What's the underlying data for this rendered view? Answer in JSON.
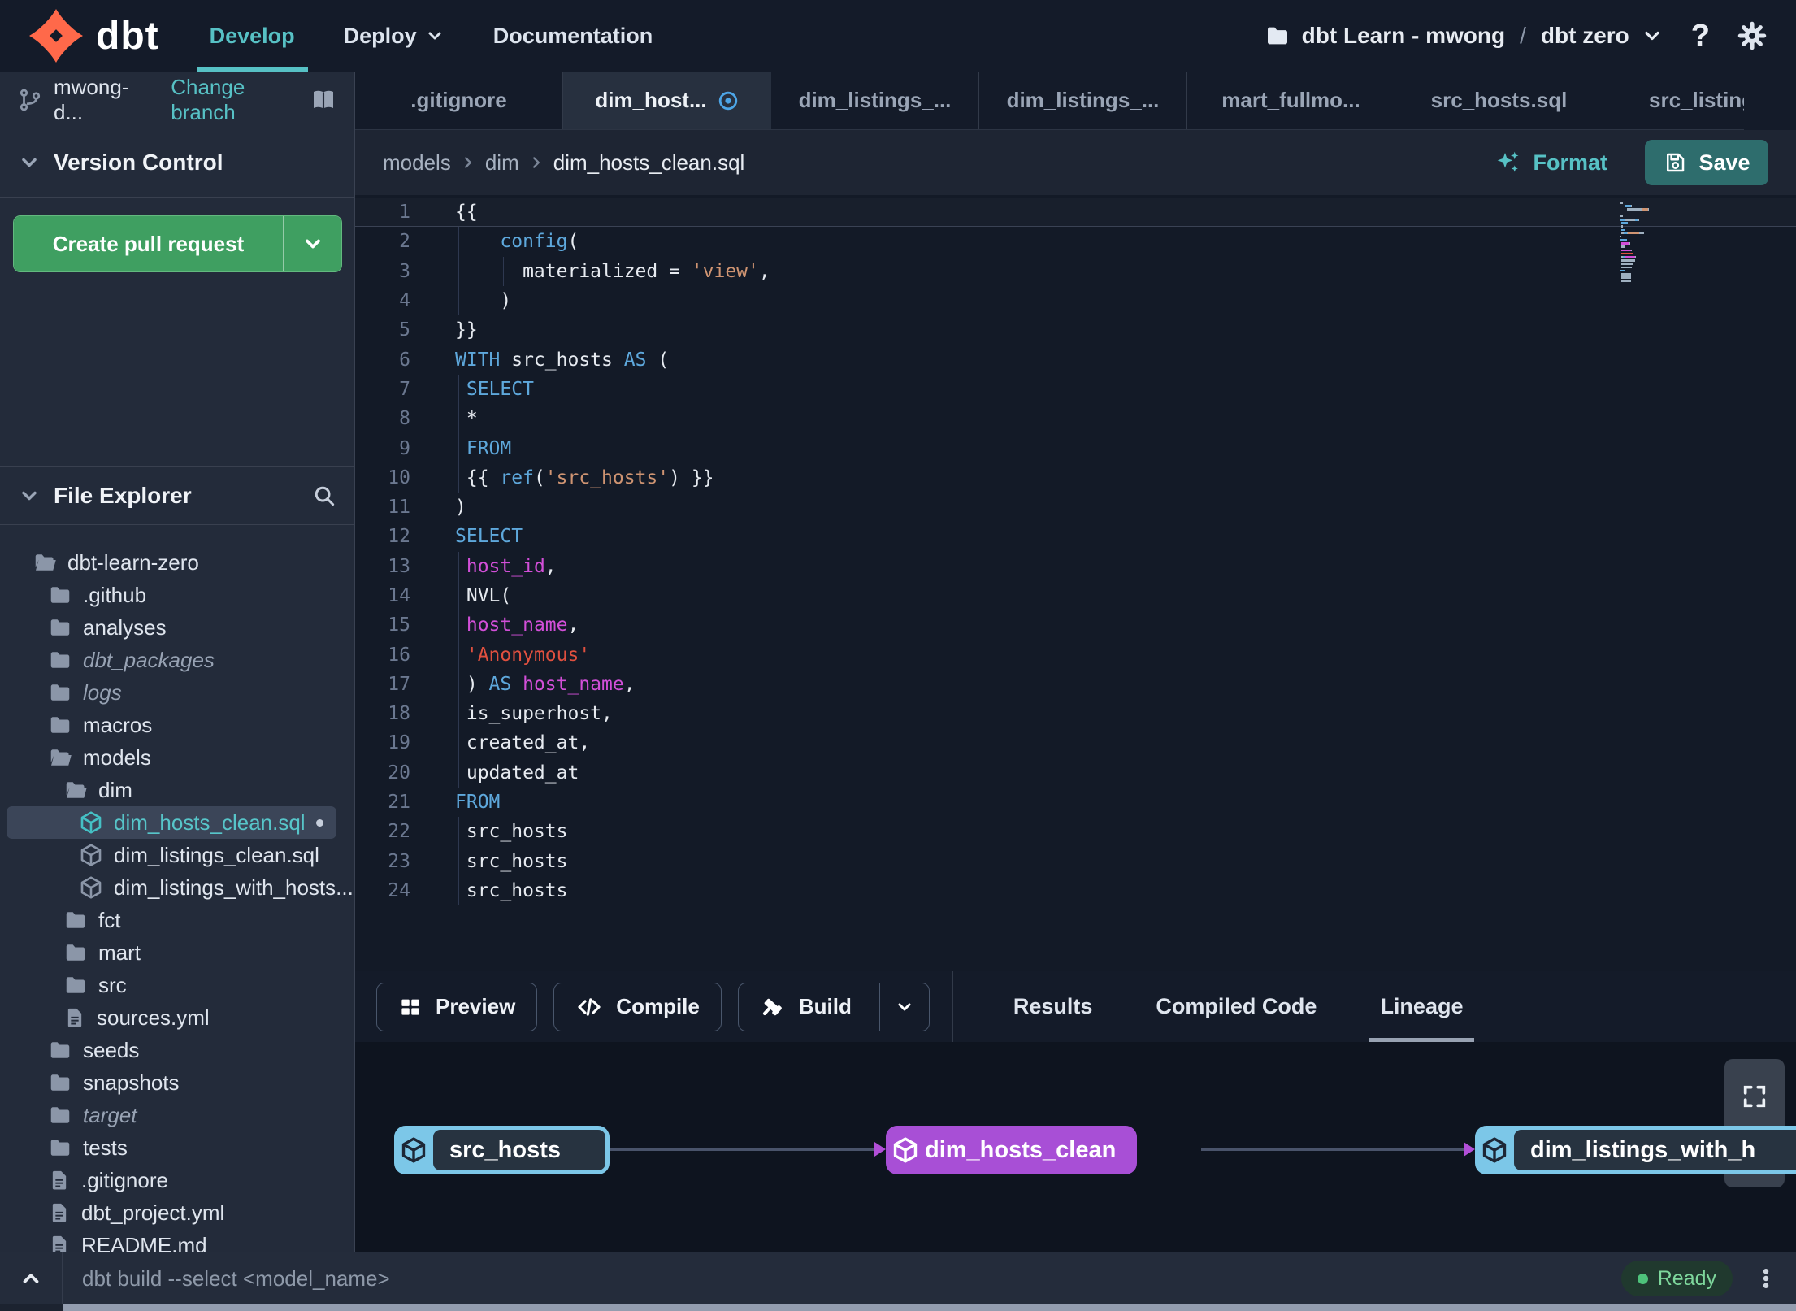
{
  "nav": {
    "brand": "dbt",
    "items": [
      {
        "label": "Develop",
        "active": true
      },
      {
        "label": "Deploy",
        "chevron": true
      },
      {
        "label": "Documentation"
      }
    ],
    "project": {
      "account": "dbt Learn - mwong",
      "separator": "/",
      "env": "dbt zero"
    }
  },
  "sidebar": {
    "branch": {
      "name": "mwong-d...",
      "action": "Change branch"
    },
    "version_control": {
      "title": "Version Control",
      "button": "Create pull request"
    },
    "file_explorer": {
      "title": "File Explorer"
    },
    "tree": [
      {
        "name": "dbt-learn-zero",
        "type": "folder-open",
        "depth": 0
      },
      {
        "name": ".github",
        "type": "folder",
        "depth": 1
      },
      {
        "name": "analyses",
        "type": "folder",
        "depth": 1
      },
      {
        "name": "dbt_packages",
        "type": "folder",
        "depth": 1,
        "italic": true
      },
      {
        "name": "logs",
        "type": "folder",
        "depth": 1,
        "italic": true
      },
      {
        "name": "macros",
        "type": "folder",
        "depth": 1
      },
      {
        "name": "models",
        "type": "folder-open",
        "depth": 1
      },
      {
        "name": "dim",
        "type": "folder-open",
        "depth": 2
      },
      {
        "name": "dim_hosts_clean.sql",
        "type": "model",
        "depth": 3,
        "selected": true,
        "dot": true
      },
      {
        "name": "dim_listings_clean.sql",
        "type": "model",
        "depth": 3
      },
      {
        "name": "dim_listings_with_hosts...",
        "type": "model",
        "depth": 3
      },
      {
        "name": "fct",
        "type": "folder",
        "depth": 2
      },
      {
        "name": "mart",
        "type": "folder",
        "depth": 2
      },
      {
        "name": "src",
        "type": "folder",
        "depth": 2
      },
      {
        "name": "sources.yml",
        "type": "file",
        "depth": 2
      },
      {
        "name": "seeds",
        "type": "folder",
        "depth": 1
      },
      {
        "name": "snapshots",
        "type": "folder",
        "depth": 1
      },
      {
        "name": "target",
        "type": "folder",
        "depth": 1,
        "italic": true
      },
      {
        "name": "tests",
        "type": "folder",
        "depth": 1
      },
      {
        "name": ".gitignore",
        "type": "file",
        "depth": 1
      },
      {
        "name": "dbt_project.yml",
        "type": "file",
        "depth": 1
      },
      {
        "name": "README.md",
        "type": "file",
        "depth": 1
      }
    ]
  },
  "tabs": [
    {
      "label": ".gitignore"
    },
    {
      "label": "dim_host...",
      "active": true,
      "dirty": true
    },
    {
      "label": "dim_listings_..."
    },
    {
      "label": "dim_listings_..."
    },
    {
      "label": "mart_fullmo..."
    },
    {
      "label": "src_hosts.sql"
    },
    {
      "label": "src_listings.",
      "last": true
    }
  ],
  "editor": {
    "breadcrumb": [
      "models",
      "dim",
      "dim_hosts_clean.sql"
    ],
    "format_label": "Format",
    "save_label": "Save",
    "code": [
      {
        "n": 1,
        "cur": true,
        "g": [],
        "t": [
          [
            "p",
            "{{"
          ]
        ]
      },
      {
        "n": 2,
        "g": [
          0
        ],
        "t": [
          [
            "p",
            "    "
          ],
          [
            "k",
            "config"
          ],
          [
            "p",
            "("
          ]
        ]
      },
      {
        "n": 3,
        "g": [
          0,
          4
        ],
        "t": [
          [
            "p",
            "      materialized = "
          ],
          [
            "s",
            "'view'"
          ],
          [
            "p",
            ","
          ]
        ]
      },
      {
        "n": 4,
        "g": [
          0
        ],
        "t": [
          [
            "p",
            "    )"
          ]
        ]
      },
      {
        "n": 5,
        "g": [],
        "t": [
          [
            "p",
            "}}"
          ]
        ]
      },
      {
        "n": 6,
        "g": [],
        "t": [
          [
            "k",
            "WITH"
          ],
          [
            "p",
            " src_hosts "
          ],
          [
            "k",
            "AS"
          ],
          [
            "p",
            " ("
          ]
        ]
      },
      {
        "n": 7,
        "g": [
          0
        ],
        "t": [
          [
            "p",
            " "
          ],
          [
            "k",
            "SELECT"
          ]
        ]
      },
      {
        "n": 8,
        "g": [
          0
        ],
        "t": [
          [
            "p",
            " *"
          ]
        ]
      },
      {
        "n": 9,
        "g": [
          0
        ],
        "t": [
          [
            "p",
            " "
          ],
          [
            "k",
            "FROM"
          ]
        ]
      },
      {
        "n": 10,
        "g": [
          0
        ],
        "t": [
          [
            "p",
            " {{ "
          ],
          [
            "k",
            "ref"
          ],
          [
            "p",
            "("
          ],
          [
            "s",
            "'src_hosts'"
          ],
          [
            "p",
            ") }}"
          ]
        ]
      },
      {
        "n": 11,
        "g": [],
        "t": [
          [
            "p",
            ")"
          ]
        ]
      },
      {
        "n": 12,
        "g": [],
        "t": [
          [
            "k",
            "SELECT"
          ]
        ]
      },
      {
        "n": 13,
        "g": [
          0
        ],
        "t": [
          [
            "p",
            " "
          ],
          [
            "m",
            "host_id"
          ],
          [
            "p",
            ","
          ]
        ]
      },
      {
        "n": 14,
        "g": [
          0
        ],
        "t": [
          [
            "p",
            " NVL("
          ]
        ]
      },
      {
        "n": 15,
        "g": [
          0
        ],
        "t": [
          [
            "p",
            " "
          ],
          [
            "m",
            "host_name"
          ],
          [
            "p",
            ","
          ]
        ]
      },
      {
        "n": 16,
        "g": [
          0
        ],
        "t": [
          [
            "p",
            " "
          ],
          [
            "r",
            "'Anonymous'"
          ]
        ]
      },
      {
        "n": 17,
        "g": [
          0
        ],
        "t": [
          [
            "p",
            " ) "
          ],
          [
            "k",
            "AS"
          ],
          [
            "p",
            " "
          ],
          [
            "m",
            "host_name"
          ],
          [
            "p",
            ","
          ]
        ]
      },
      {
        "n": 18,
        "g": [
          0
        ],
        "t": [
          [
            "p",
            " is_superhost,"
          ]
        ]
      },
      {
        "n": 19,
        "g": [
          0
        ],
        "t": [
          [
            "p",
            " created_at,"
          ]
        ]
      },
      {
        "n": 20,
        "g": [
          0
        ],
        "t": [
          [
            "p",
            " updated_at"
          ]
        ]
      },
      {
        "n": 21,
        "g": [],
        "t": [
          [
            "k",
            "FROM"
          ]
        ]
      },
      {
        "n": 22,
        "g": [
          0
        ],
        "t": [
          [
            "p",
            " src_hosts"
          ]
        ]
      },
      {
        "n": 23,
        "g": [
          0
        ],
        "t": [
          [
            "p",
            " src_hosts"
          ]
        ]
      },
      {
        "n": 24,
        "g": [
          0
        ],
        "t": [
          [
            "p",
            " src_hosts"
          ]
        ]
      }
    ]
  },
  "bottom": {
    "actions": [
      {
        "label": "Preview",
        "icon": "grid"
      },
      {
        "label": "Compile",
        "icon": "code"
      },
      {
        "label": "Build",
        "icon": "hammer",
        "split": true
      }
    ],
    "tabs": [
      {
        "label": "Results"
      },
      {
        "label": "Compiled Code"
      },
      {
        "label": "Lineage",
        "active": true
      }
    ]
  },
  "lineage": {
    "nodes": [
      {
        "label": "src_hosts",
        "variant": "blue"
      },
      {
        "label": "dim_hosts_clean",
        "variant": "purple"
      },
      {
        "label": "dim_listings_with_h",
        "variant": "blue"
      }
    ]
  },
  "statusbar": {
    "command": "dbt build --select <model_name>",
    "status": "Ready"
  },
  "colors": {
    "accent": "#57c1c5",
    "green_button": "#3f9f61",
    "save_button": "#2e6d6d",
    "node_blue": "#7cc7e8",
    "node_purple": "#a84fd6",
    "code_keyword": "#5ea8dc",
    "code_string": "#cf9472",
    "code_red": "#e0503f",
    "code_magenta": "#d24fd8",
    "code_plain": "#e6eaf0",
    "status_green": "#4ec27b"
  }
}
